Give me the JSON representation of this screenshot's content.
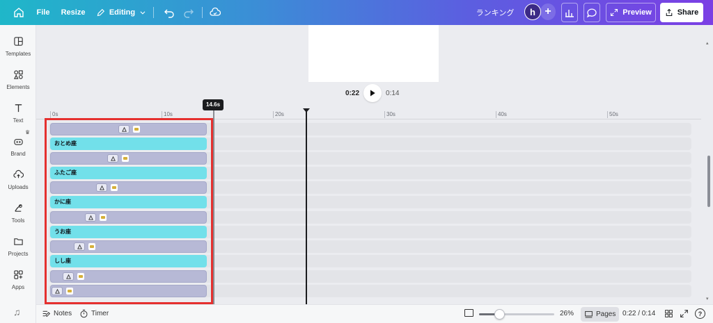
{
  "topbar": {
    "file_label": "File",
    "resize_label": "Resize",
    "editing_label": "Editing",
    "title": "ランキング",
    "avatar_letter": "h",
    "preview_label": "Preview",
    "share_label": "Share"
  },
  "sidebar": {
    "items": [
      {
        "label": "Templates",
        "icon": "templates-icon"
      },
      {
        "label": "Elements",
        "icon": "elements-icon"
      },
      {
        "label": "Text",
        "icon": "text-icon"
      },
      {
        "label": "Brand",
        "icon": "brand-icon"
      },
      {
        "label": "Uploads",
        "icon": "uploads-icon"
      },
      {
        "label": "Tools",
        "icon": "tools-icon"
      },
      {
        "label": "Projects",
        "icon": "projects-icon"
      },
      {
        "label": "Apps",
        "icon": "apps-icon"
      }
    ]
  },
  "player": {
    "current_time": "0:22",
    "total_time": "0:14"
  },
  "timeline": {
    "ruler_ticks": [
      "0s",
      "10s",
      "20s",
      "30s",
      "40s",
      "50s"
    ],
    "trim_tooltip": "14.6s",
    "text_tracks": [
      "おとめ座",
      "ふたご座",
      "かに座",
      "うお座",
      "しし座"
    ]
  },
  "bottombar": {
    "notes_label": "Notes",
    "timer_label": "Timer",
    "zoom_percent": "26%",
    "pages_label": "Pages",
    "time_readout": "0:22 / 0:14"
  },
  "colors": {
    "accent_cyan": "#72e0ea",
    "clip_lavender": "#b7b9d6",
    "highlight_red": "#e5302f"
  }
}
